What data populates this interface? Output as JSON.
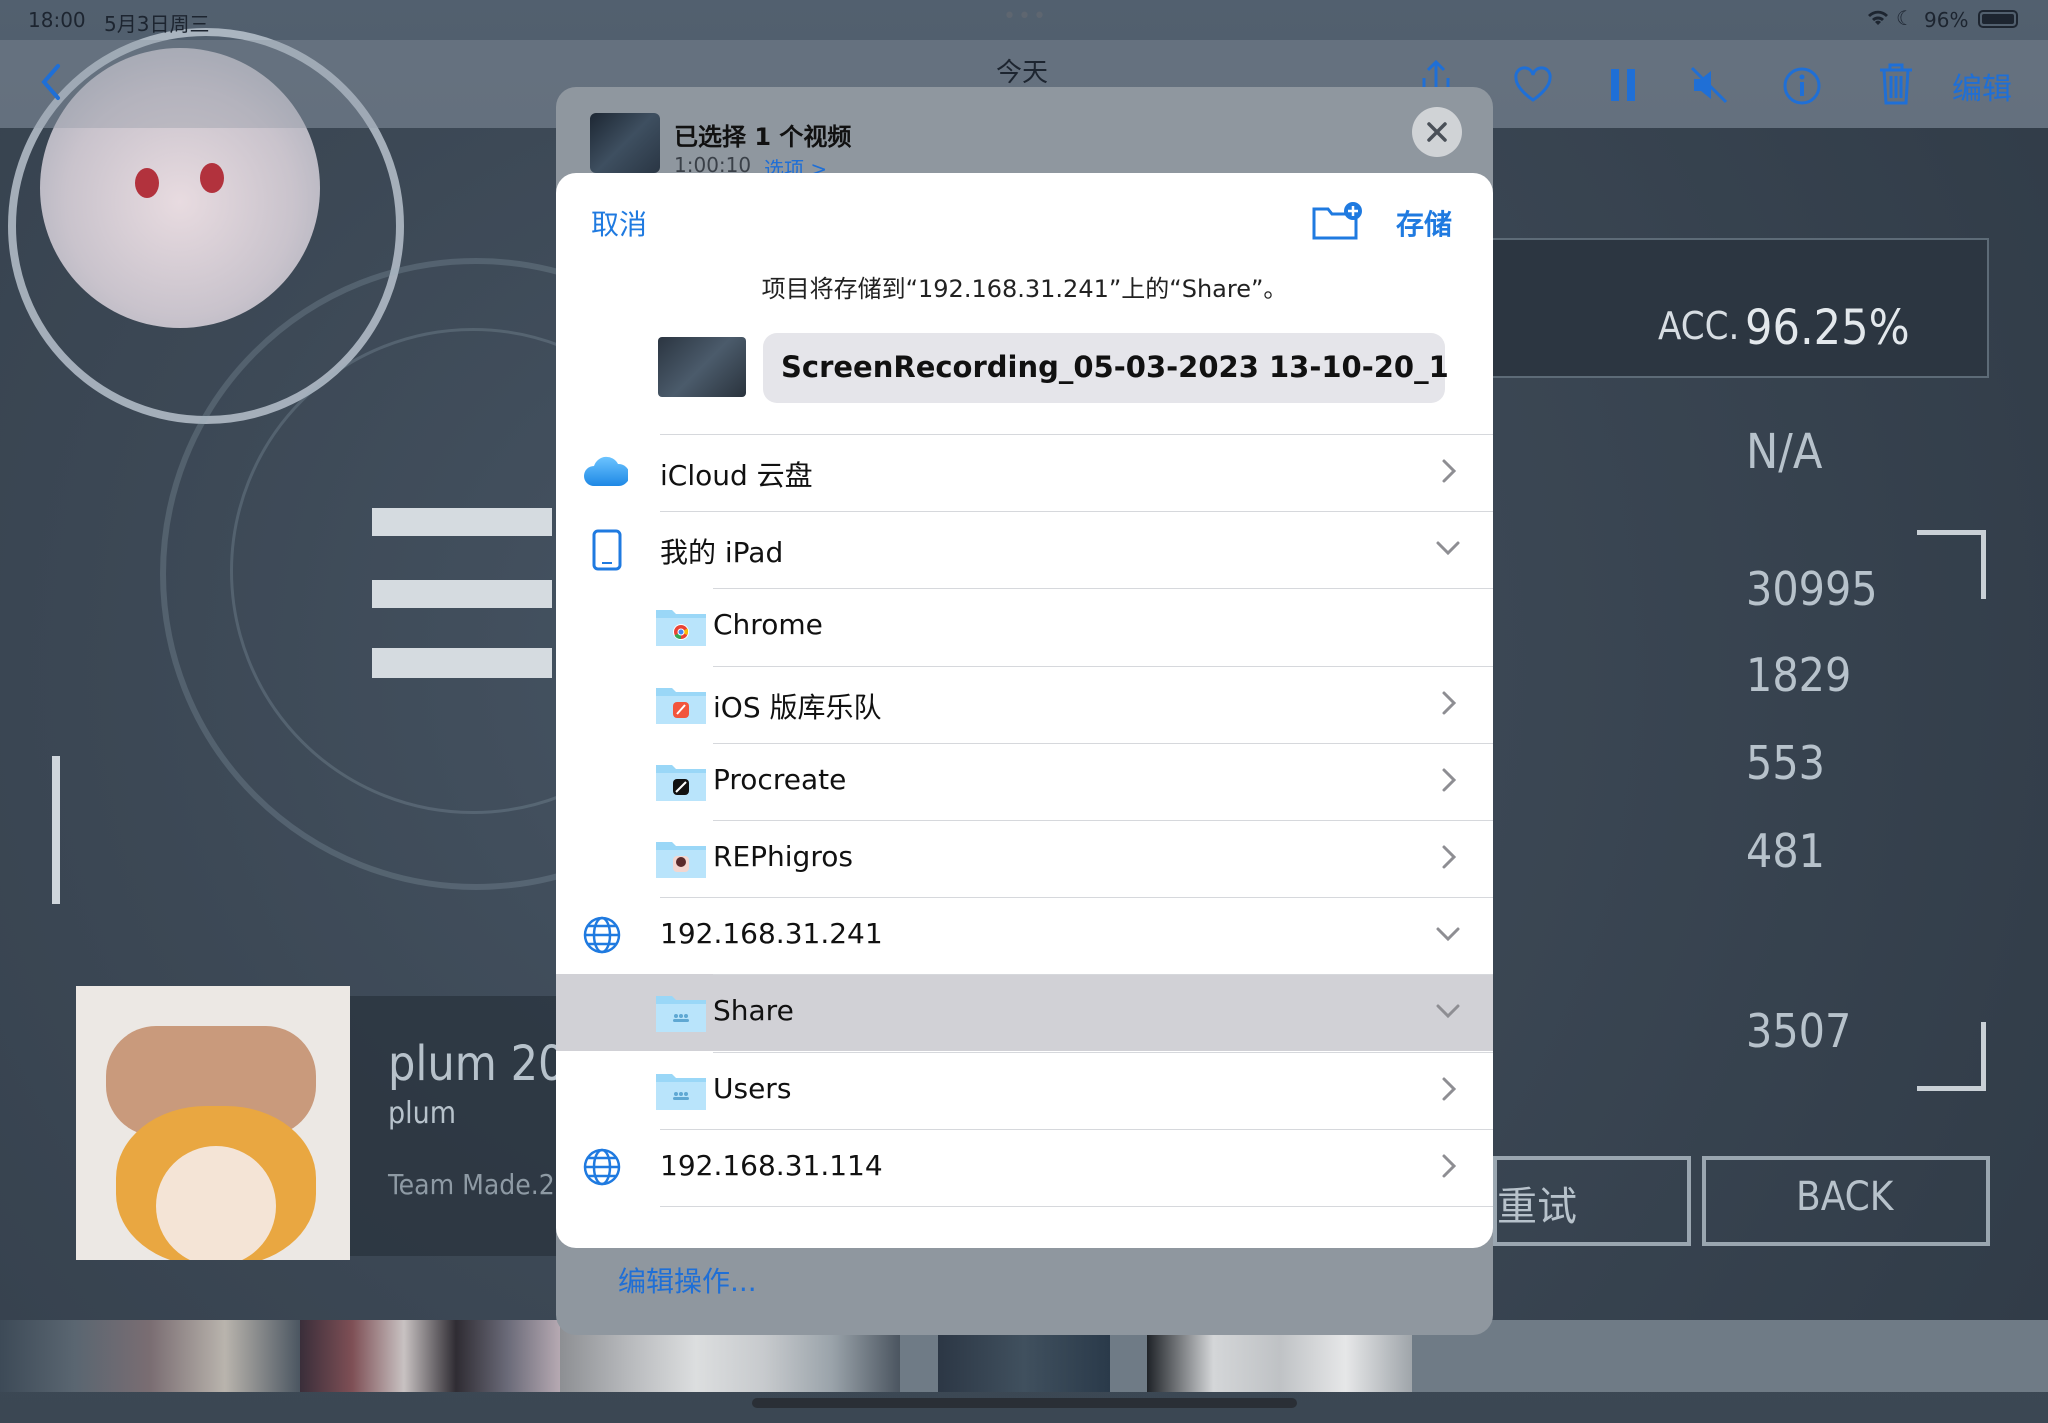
{
  "status_bar": {
    "time": "18:00",
    "date": "5月3日周三",
    "battery": "96%"
  },
  "nav_bar": {
    "title": "今天",
    "edit_label": "编辑"
  },
  "game_bg": {
    "acc_label": "ACC.",
    "acc_value": "96.25%",
    "rating": "N/A",
    "stats": [
      "30995",
      "1829",
      "553",
      "481",
      "3507"
    ],
    "song_title": "plum 20n",
    "artist": "plum",
    "team": "Team Made.20",
    "retry_label": "重试",
    "back_label": "BACK"
  },
  "share_header": {
    "title": "已选择 1 个视频",
    "duration": "1:00:10",
    "options_label": "选项 >"
  },
  "dialog": {
    "cancel_label": "取消",
    "save_label": "存储",
    "info_text": "项目将存储到“192.168.31.241”上的“Share”。",
    "filename": "ScreenRecording_05-03-2023 13-10-20_1"
  },
  "locations": [
    {
      "label": "iCloud 云盘",
      "icon": "icloud-icon",
      "chevron": "right",
      "level": 0
    },
    {
      "label": "我的 iPad",
      "icon": "ipad-icon",
      "chevron": "down",
      "level": 0
    },
    {
      "label": "Chrome",
      "icon": "chrome-folder-icon",
      "chevron": "none",
      "level": 1
    },
    {
      "label": "iOS 版库乐队",
      "icon": "garageband-folder-icon",
      "chevron": "right",
      "level": 1
    },
    {
      "label": "Procreate",
      "icon": "procreate-folder-icon",
      "chevron": "right",
      "level": 1
    },
    {
      "label": "REPhigros",
      "icon": "rephigros-folder-icon",
      "chevron": "right",
      "level": 1
    },
    {
      "label": "192.168.31.241",
      "icon": "globe-icon",
      "chevron": "down",
      "level": 0
    },
    {
      "label": "Share",
      "icon": "shared-folder-icon",
      "chevron": "down",
      "level": 1,
      "selected": true
    },
    {
      "label": "Users",
      "icon": "shared-folder-icon",
      "chevron": "right",
      "level": 1
    },
    {
      "label": "192.168.31.114",
      "icon": "globe-icon",
      "chevron": "right",
      "level": 0
    }
  ],
  "edit_actions_label": "编辑操作...",
  "colors": {
    "accent": "#1f7ae0",
    "selected_row": "#d1d1d6",
    "folder": "#8fd0f5"
  }
}
